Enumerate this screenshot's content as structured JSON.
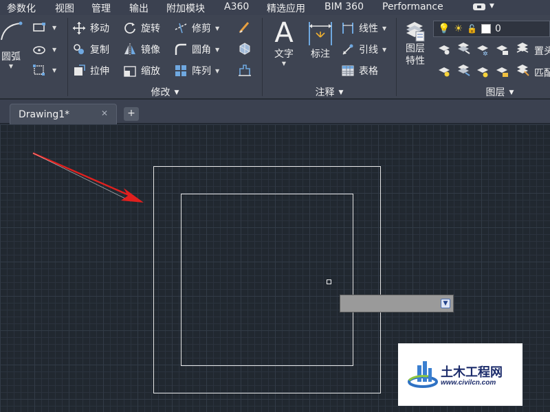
{
  "menu": {
    "items": [
      "参数化",
      "视图",
      "管理",
      "输出",
      "附加模块",
      "A360",
      "精选应用",
      "BIM 360",
      "Performance"
    ]
  },
  "ribbon": {
    "draw": {
      "arc_label": "圆弧"
    },
    "modify": {
      "title": "修改",
      "move": "移动",
      "rotate": "旋转",
      "trim": "修剪",
      "copy": "复制",
      "mirror": "镜像",
      "fillet": "圆角",
      "stretch": "拉伸",
      "scale": "缩放",
      "array": "阵列"
    },
    "annotation": {
      "title": "注释",
      "text": "文字",
      "dimension": "标注",
      "linear": "线性",
      "leader": "引线",
      "table": "表格"
    },
    "layers": {
      "title": "图层",
      "properties_line1": "图层",
      "properties_line2": "特性",
      "current_layer": "0",
      "set_current_partial": "置头",
      "match_partial": "匹配"
    }
  },
  "file_tab": {
    "name": "Drawing1*",
    "close": "✕",
    "new": "+"
  },
  "dynamic_input": {
    "value": ""
  },
  "watermark": {
    "title": "土木工程网",
    "url": "www.civilcn.com"
  },
  "colors": {
    "ribbon_bg": "#3e4452",
    "menubar_bg": "#3b4150",
    "canvas_bg": "#212830",
    "geometry_stroke": "#e8e8e8",
    "arrow_red": "#e0201e",
    "watermark_blue": "#1c2c6b"
  },
  "icons": [
    "arc-icon",
    "rectangle-icon",
    "move-icon",
    "rotate-icon",
    "trim-icon",
    "erase-icon",
    "copy-icon",
    "mirror-icon",
    "fillet-icon",
    "explode-icon",
    "stretch-icon",
    "scale-icon",
    "array-icon",
    "offset-icon",
    "text-icon",
    "dimension-icon",
    "linear-icon",
    "leader-icon",
    "table-icon",
    "layer-properties-icon",
    "lightbulb-icon",
    "sun-icon",
    "lock-icon"
  ]
}
